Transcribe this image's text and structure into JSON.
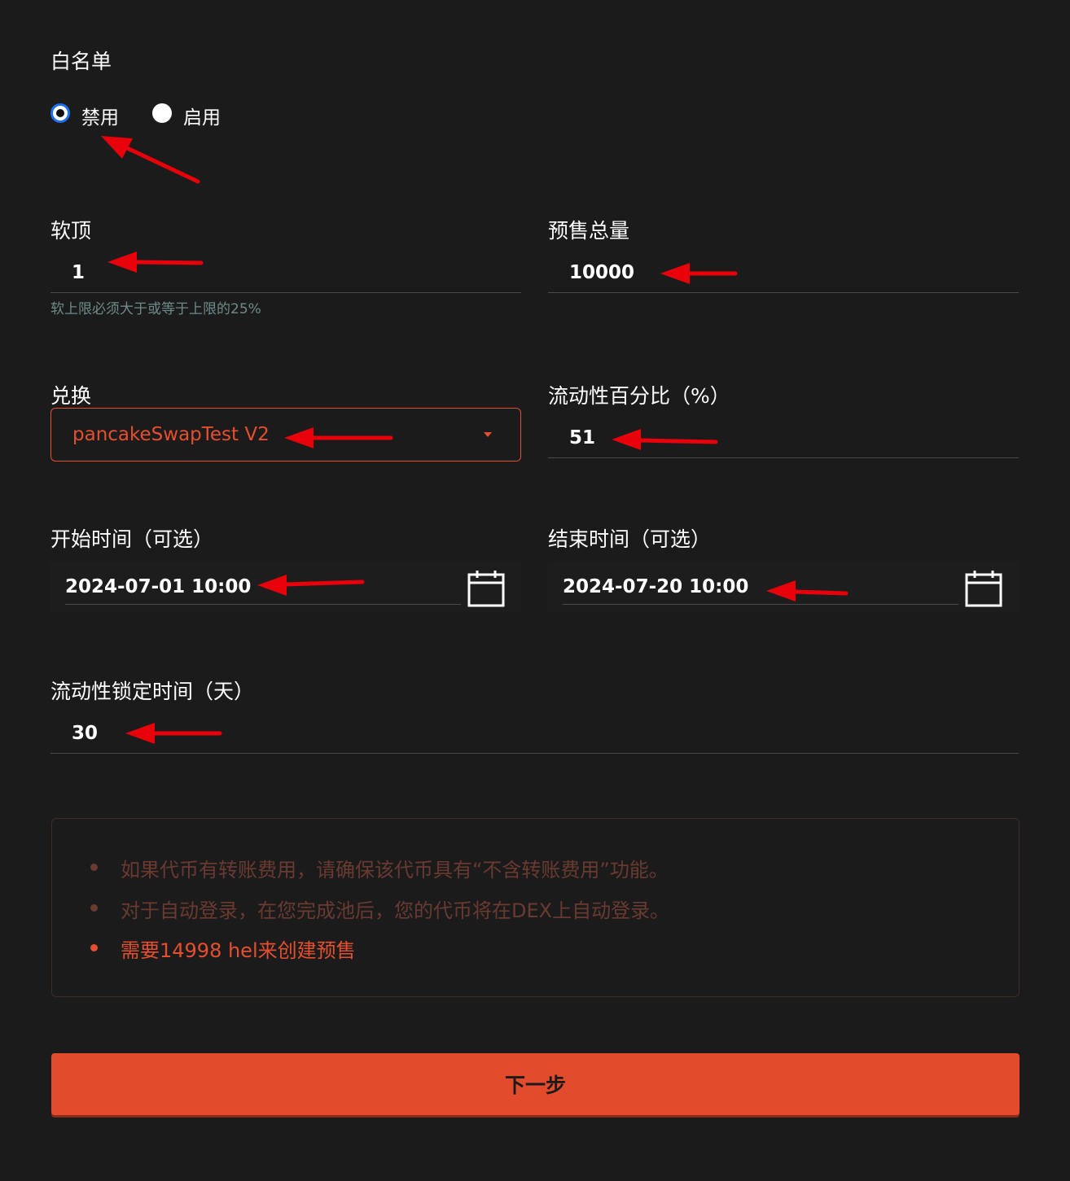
{
  "whitelist": {
    "label": "白名单",
    "options": [
      {
        "label": "禁用",
        "selected": true
      },
      {
        "label": "启用",
        "selected": false
      }
    ]
  },
  "soft_cap": {
    "label": "软顶",
    "value": "1",
    "helper": "软上限必须大于或等于上限的25%"
  },
  "presale_total": {
    "label": "预售总量",
    "value": "10000"
  },
  "exchange": {
    "label": "兑换",
    "selected": "pancakeSwapTest V2"
  },
  "liquidity_percent": {
    "label": "流动性百分比（%）",
    "value": "51"
  },
  "start_time": {
    "label": "开始时间（可选）",
    "value": "2024-07-01 10:00"
  },
  "end_time": {
    "label": "结束时间（可选）",
    "value": "2024-07-20 10:00"
  },
  "lock_days": {
    "label": "流动性锁定时间（天）",
    "value": "30"
  },
  "notice": {
    "items": [
      {
        "text": "如果代币有转账费用，请确保该代币具有“不含转账费用”功能。",
        "color": "#6a3a30"
      },
      {
        "text": "对于自动登录，在您完成池后，您的代币将在DEX上自动登录。",
        "color": "#6a3a30"
      },
      {
        "text": "需要14998 hel来创建预售",
        "color": "#e4502f"
      }
    ]
  },
  "next_button": {
    "label": "下一步"
  },
  "colors": {
    "accent": "#e34b2d",
    "background": "#1b1b1b",
    "annotation_arrow": "#e8000b"
  },
  "icons": [
    "calendar-icon",
    "caret-down-icon",
    "annotation-arrow"
  ]
}
